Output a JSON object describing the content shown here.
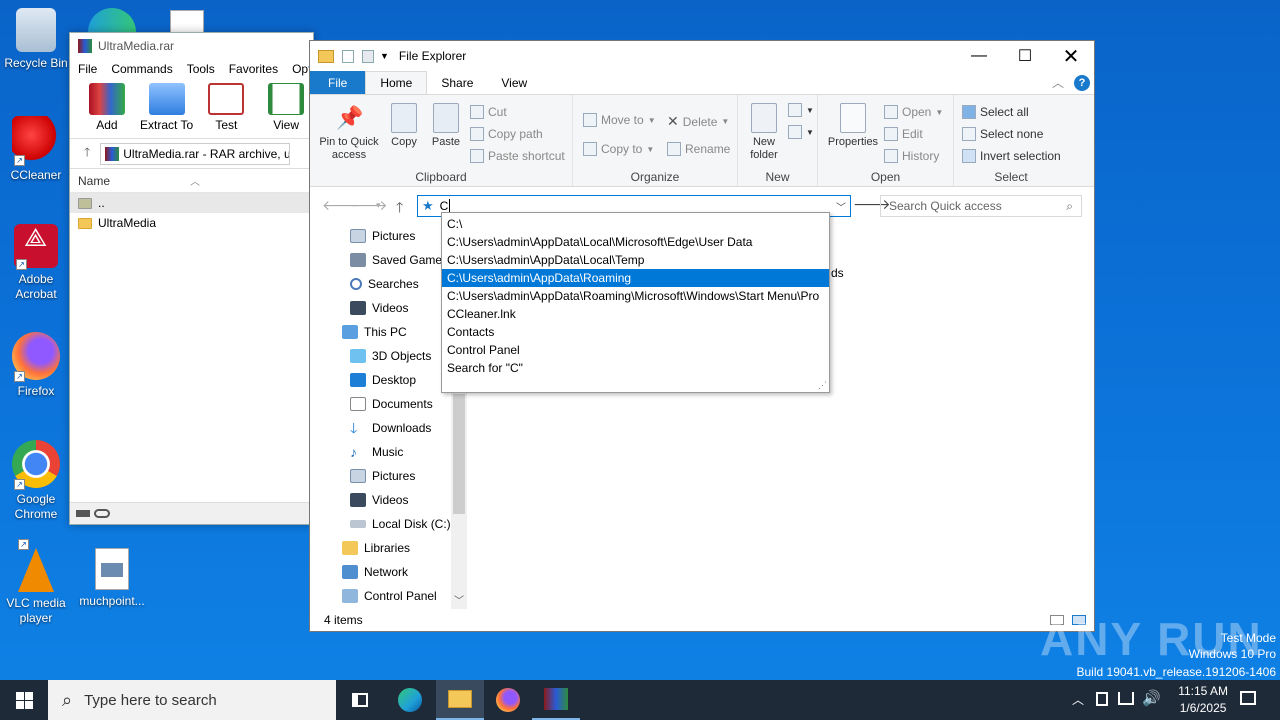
{
  "desktop": {
    "icons": [
      {
        "label": "Recycle Bin"
      },
      {
        "label": "CCleaner"
      },
      {
        "label": "Adobe Acrobat"
      },
      {
        "label": "Firefox"
      },
      {
        "label": "Google Chrome"
      },
      {
        "label": "VLC media player"
      },
      {
        "label": "muchpoint..."
      }
    ]
  },
  "winrar": {
    "title": "UltraMedia.rar",
    "menu": [
      "File",
      "Commands",
      "Tools",
      "Favorites",
      "Opti"
    ],
    "toolbar": [
      "Add",
      "Extract To",
      "Test",
      "View"
    ],
    "path": "UltraMedia.rar - RAR archive, u",
    "column_name": "Name",
    "rows": [
      "..",
      "UltraMedia"
    ]
  },
  "explorer": {
    "title": "File Explorer",
    "tabs": [
      "File",
      "Home",
      "Share",
      "View"
    ],
    "ribbon": {
      "clipboard": {
        "label": "Clipboard",
        "pin": "Pin to Quick access",
        "copy": "Copy",
        "paste": "Paste",
        "cut": "Cut",
        "copy_path": "Copy path",
        "paste_shortcut": "Paste shortcut"
      },
      "organize": {
        "label": "Organize",
        "move_to": "Move to",
        "copy_to": "Copy to",
        "delete": "Delete",
        "rename": "Rename"
      },
      "new": {
        "label": "New",
        "new_folder": "New folder"
      },
      "open": {
        "label": "Open",
        "properties": "Properties",
        "open": "Open",
        "edit": "Edit",
        "history": "History"
      },
      "select": {
        "label": "Select",
        "select_all": "Select all",
        "select_none": "Select none",
        "invert": "Invert selection"
      }
    },
    "address_value": "C",
    "search_placeholder": "Search Quick access",
    "nav_items": [
      "Pictures",
      "Saved Games",
      "Searches",
      "Videos",
      "This PC",
      "3D Objects",
      "Desktop",
      "Documents",
      "Downloads",
      "Music",
      "Pictures",
      "Videos",
      "Local Disk (C:)",
      "Libraries",
      "Network",
      "Control Panel"
    ],
    "autocomplete": [
      "C:\\",
      "C:\\Users\\admin\\AppData\\Local\\Microsoft\\Edge\\User Data",
      "C:\\Users\\admin\\AppData\\Local\\Temp",
      "C:\\Users\\admin\\AppData\\Roaming",
      "C:\\Users\\admin\\AppData\\Roaming\\Microsoft\\Windows\\Start Menu\\Pro",
      "CCleaner.lnk",
      "Contacts",
      "Control Panel",
      "Search for \"C\""
    ],
    "selected_autocomplete_index": 3,
    "partial_text": "ds",
    "status": "4 items"
  },
  "taskbar": {
    "search_placeholder": "Type here to search",
    "time": "11:15 AM",
    "date": "1/6/2025"
  },
  "watermark": {
    "brand": "ANY RUN",
    "line1": "Test Mode",
    "line2": "Windows 10 Pro",
    "line3": "Build 19041.vb_release.191206-1406"
  },
  "colors": {
    "accent": "#0078d7",
    "file_tab": "#1979ca",
    "taskbar": "#1f2a38"
  }
}
